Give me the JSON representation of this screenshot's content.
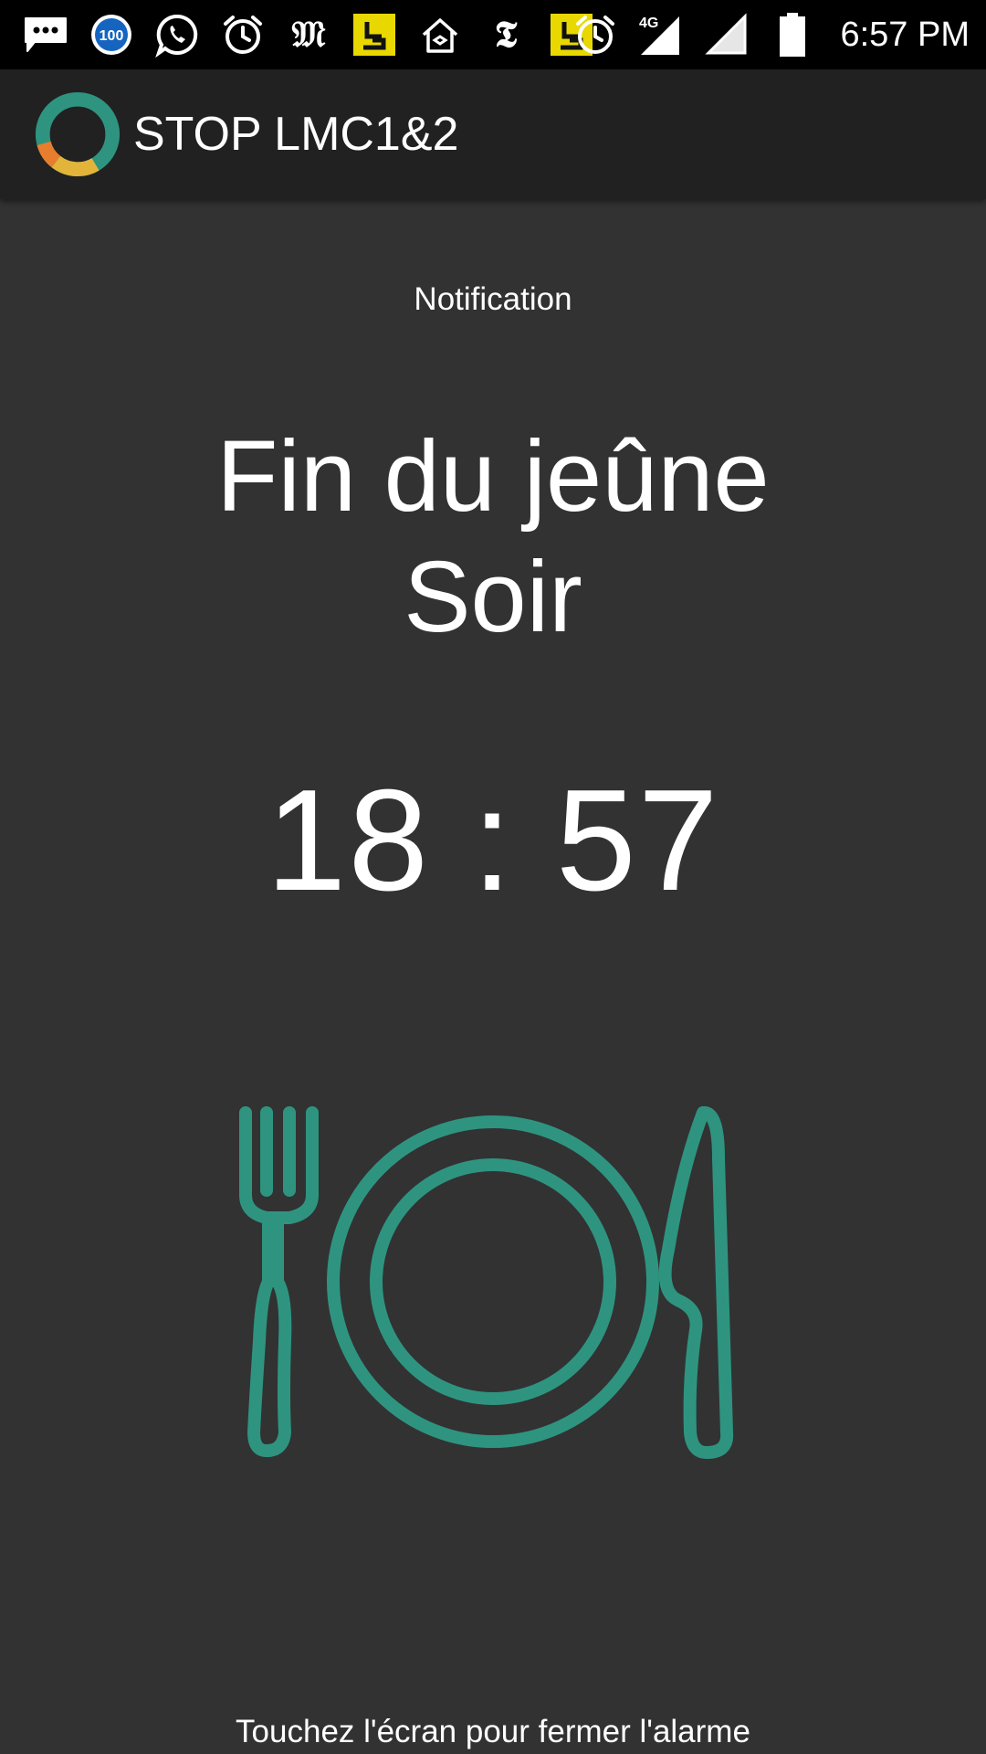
{
  "status_bar": {
    "time": "6:57 PM",
    "network_label": "4G",
    "badge_number": "100",
    "left_icons": [
      "messages-icon",
      "badge-100-icon",
      "whatsapp-icon",
      "alarm-clock-icon",
      "le-monde-icon",
      "pj-app-icon",
      "home-icon",
      "nyt-icon",
      "pj-app-icon"
    ],
    "right_icons": [
      "alarm-clock-icon",
      "signal-4g-icon",
      "signal-icon",
      "battery-icon"
    ]
  },
  "app_bar": {
    "title": "STOP LMC1&2",
    "logo_icon": "ring-logo-icon"
  },
  "alarm": {
    "notification_label": "Notification",
    "title_line1": "Fin du jeûne",
    "title_line2": "Soir",
    "time": "18 : 57",
    "illustration_icon": "plate-fork-knife-icon",
    "dismiss_hint": "Touchez l'écran pour fermer l'alarme"
  },
  "colors": {
    "background": "#323232",
    "app_bar": "#212121",
    "status_bar": "#000000",
    "accent_teal": "#2E9480",
    "logo_orange": "#E67E2E",
    "logo_yellow": "#E2B43A",
    "pj_yellow": "#E8D800"
  }
}
